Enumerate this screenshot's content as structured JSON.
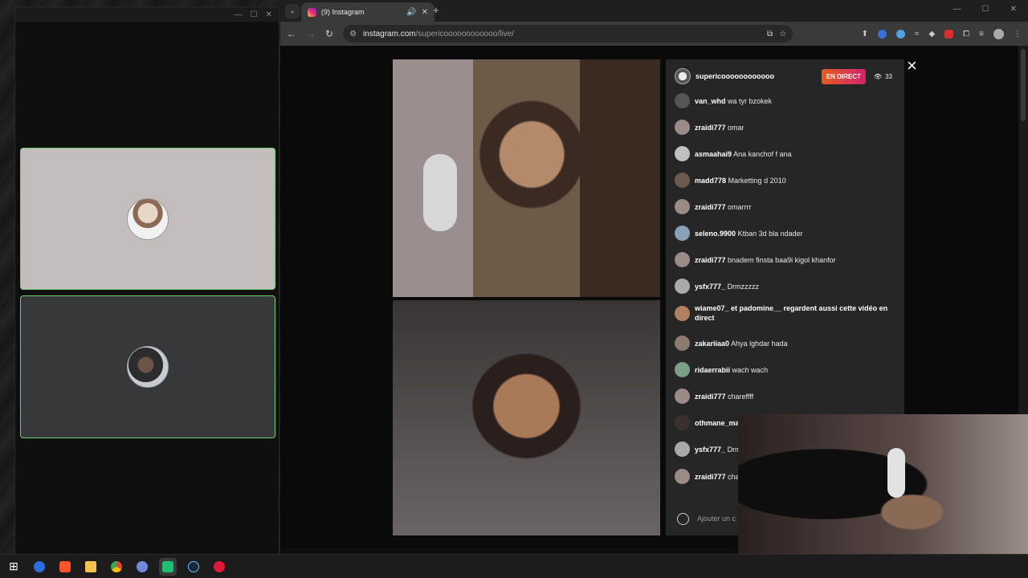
{
  "call_window": {
    "controls": [
      "—",
      "☐",
      "✕"
    ]
  },
  "browser": {
    "tab": {
      "title": "(9) Instagram"
    },
    "new_tab": "+",
    "window_controls": [
      "—",
      "☐",
      "✕"
    ],
    "url": {
      "host": "instagram.com",
      "path": "/supericoooooooooooo/live/"
    }
  },
  "live": {
    "host": "supericoooooooooooo",
    "badge": "EN DIRECT",
    "viewers": "33",
    "close": "×",
    "input_placeholder": "Ajouter un c",
    "messages": [
      {
        "user": "van_whd",
        "text": "wa tyr bzokek"
      },
      {
        "user": "zraidi777",
        "text": "omar"
      },
      {
        "user": "asmaahai9",
        "text": "Ana kanchof f ana"
      },
      {
        "user": "madd778",
        "text": "Marketting d 2010"
      },
      {
        "user": "zraidi777",
        "text": "omarrrr"
      },
      {
        "user": "seleno.9900",
        "text": "Ktban 3d bla ndader"
      },
      {
        "user": "zraidi777",
        "text": "bnadem finsta baa9i kigol khanfor"
      },
      {
        "user": "ysfx777_",
        "text": "Drmzzzzz"
      },
      {
        "user": "wiame07_ et padomine__ regardent aussi cette vidéo en direct",
        "text": ""
      },
      {
        "user": "zakariiaa0",
        "text": "Ahya lghdar hada"
      },
      {
        "user": "ridaerrabii",
        "text": "wach wach"
      },
      {
        "user": "zraidi777",
        "text": "chareffff"
      },
      {
        "user": "othmane_ma",
        "text": ""
      },
      {
        "user": "ysfx777_",
        "text": "Drm"
      },
      {
        "user": "zraidi777",
        "text": "cha"
      }
    ]
  },
  "colors": {
    "tile_border": "#6fce6f",
    "badge_start": "#e75d1f",
    "badge_end": "#d0236d",
    "chat_bg": "#262626"
  },
  "taskbar": {
    "icons": [
      "windows-start-icon",
      "browser-g-icon",
      "brave-icon",
      "file-explorer-icon",
      "chrome-icon",
      "discord-icon",
      "gamepad-app-icon",
      "steam-icon",
      "red-app-icon"
    ]
  }
}
